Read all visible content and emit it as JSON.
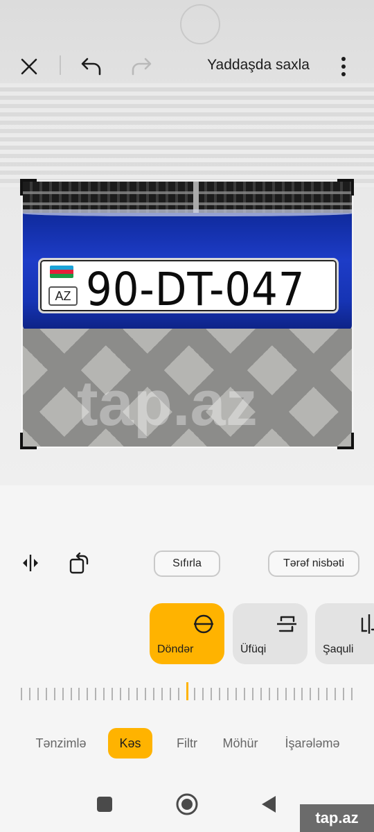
{
  "topbar": {
    "save_label": "Yaddaşda saxla",
    "icons": [
      "close-icon",
      "undo-icon",
      "redo-icon",
      "more-vert-icon"
    ]
  },
  "photo": {
    "plate_country": "AZ",
    "plate_number": "90-DT-047",
    "watermark": "tap.az"
  },
  "controls": {
    "reset_label": "Sıfırla",
    "aspect_label": "Tərəf nisbəti",
    "icons": [
      "flip-icon",
      "rotate-icon"
    ]
  },
  "cards": [
    {
      "label": "Döndər",
      "icon": "rotate-circle-icon",
      "active": true
    },
    {
      "label": "Üfüqi",
      "icon": "horizontal-skew-icon",
      "active": false
    },
    {
      "label": "Şaquli",
      "icon": "vertical-skew-icon",
      "active": false
    }
  ],
  "tabs": [
    {
      "label": "Tənzimlə",
      "active": false
    },
    {
      "label": "Kəs",
      "active": true
    },
    {
      "label": "Filtr",
      "active": false
    },
    {
      "label": "Möhür",
      "active": false
    },
    {
      "label": "İşarələmə",
      "active": false
    }
  ],
  "navbar": {
    "icons": [
      "recents-square-icon",
      "home-circle-icon",
      "back-triangle-icon"
    ]
  },
  "watermark_badge": "tap.az",
  "colors": {
    "accent": "#ffb300",
    "background": "#f5f5f5",
    "card_inactive": "#e3e3e3"
  }
}
